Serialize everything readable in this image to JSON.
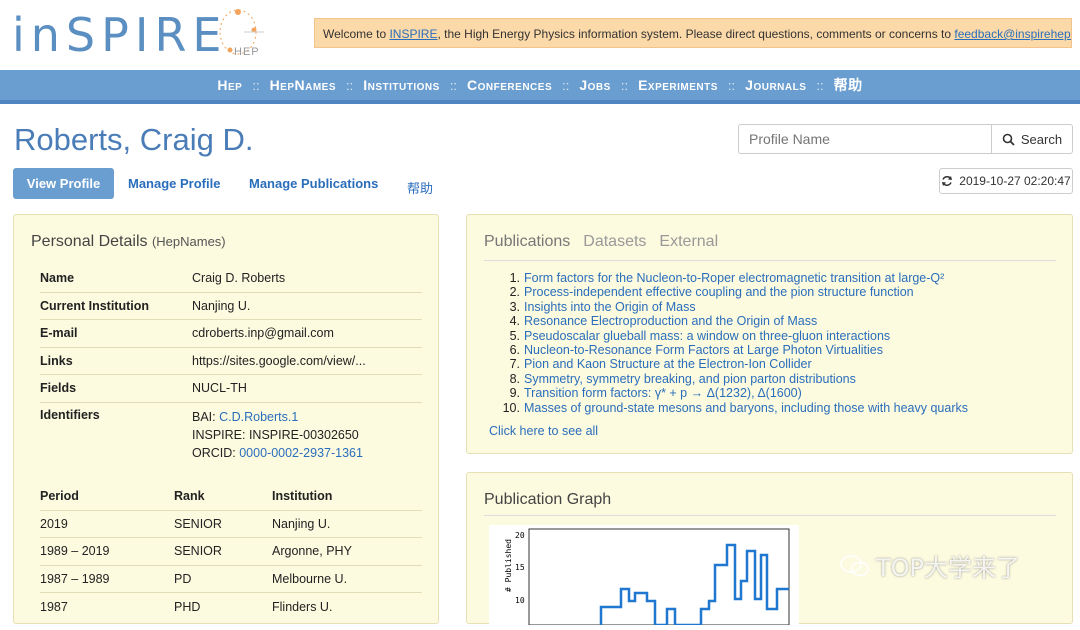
{
  "header": {
    "logo_text": "inSPIRE",
    "logo_sub": "HEP",
    "welcome_prefix": "Welcome to ",
    "welcome_link": "INSPIRE",
    "welcome_mid": ", the High Energy Physics information system. Please direct questions, comments or concerns to ",
    "welcome_email": "feedback@inspirehep.net",
    "welcome_suffix": "."
  },
  "nav": {
    "items": [
      "Hep",
      "HepNames",
      "Institutions",
      "Conferences",
      "Jobs",
      "Experiments",
      "Journals",
      "帮助"
    ],
    "separator": "::"
  },
  "profile": {
    "name": "Roberts, Craig D.",
    "search_placeholder": "Profile Name",
    "search_label": "Search",
    "tabs": [
      "View Profile",
      "Manage Profile",
      "Manage Publications",
      "帮助"
    ],
    "timestamp": "2019-10-27 02:20:47"
  },
  "personal": {
    "title": "Personal Details",
    "title_sub": "(HepNames)",
    "rows": [
      {
        "k": "Name",
        "v": "Craig D. Roberts"
      },
      {
        "k": "Current Institution",
        "v": "Nanjing U."
      },
      {
        "k": "E-mail",
        "v": "cdroberts.inp@gmail.com"
      },
      {
        "k": "Links",
        "v": "https://sites.google.com/view/..."
      },
      {
        "k": "Fields",
        "v": "NUCL-TH"
      },
      {
        "k": "Identifiers",
        "bai_label": "BAI: ",
        "bai": "C.D.Roberts.1",
        "inspire": "INSPIRE: INSPIRE-00302650",
        "orcid_label": "ORCID: ",
        "orcid": "0000-0002-2937-1361"
      }
    ],
    "positions_head": [
      "Period",
      "Rank",
      "Institution"
    ],
    "positions": [
      [
        "2019",
        "SENIOR",
        "Nanjing U."
      ],
      [
        "1989 – 2019",
        "SENIOR",
        "Argonne, PHY"
      ],
      [
        "1987 – 1989",
        "PD",
        "Melbourne U."
      ],
      [
        "1987",
        "PHD",
        "Flinders U."
      ]
    ]
  },
  "publications": {
    "tabs": [
      "Publications",
      "Datasets",
      "External"
    ],
    "items": [
      "Form factors for the Nucleon-to-Roper electromagnetic transition at large-Q²",
      "Process-independent effective coupling and the pion structure function",
      "Insights into the Origin of Mass",
      "Resonance Electroproduction and the Origin of Mass",
      "Pseudoscalar glueball mass: a window on three-gluon interactions",
      "Nucleon-to-Resonance Form Factors at Large Photon Virtualities",
      "Pion and Kaon Structure at the Electron-Ion Collider",
      "Symmetry, symmetry breaking, and pion parton distributions",
      "Transition form factors: γ* + p → Δ(1232), Δ(1600)",
      "Masses of ground-state mesons and baryons, including those with heavy quarks"
    ],
    "see_all": "Click here to see all"
  },
  "graph": {
    "title": "Publication Graph",
    "ylabel": "# Published",
    "yticks": [
      "20",
      "15",
      "10"
    ]
  },
  "watermark": "TOP大学来了",
  "colors": {
    "accent": "#6b9ed0",
    "link": "#2a6ebb",
    "panel": "#fcfadf",
    "welcome": "#fcd9a8"
  }
}
